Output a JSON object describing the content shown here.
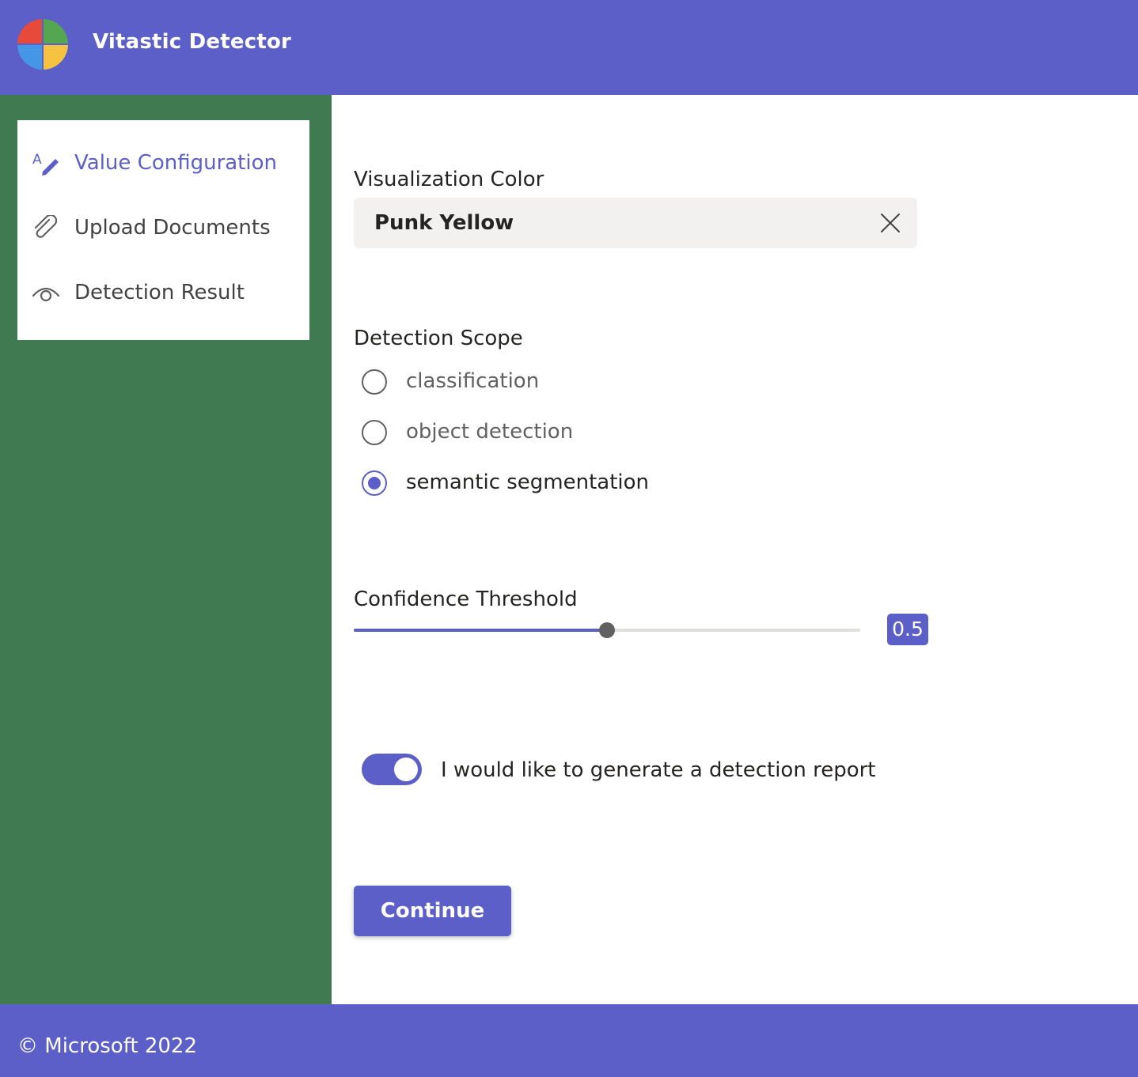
{
  "header": {
    "app_title": "Vitastic Detector",
    "logo_icon": "microsoft-style-logo",
    "logo_colors": [
      "#e64a3b",
      "#54a651",
      "#4596e6",
      "#f5c242"
    ],
    "background": "#5b5fc7"
  },
  "sidebar": {
    "background": "#3f7a50",
    "items": [
      {
        "label": "Value Configuration",
        "icon": "text-edit-icon",
        "active": true
      },
      {
        "label": "Upload Documents",
        "icon": "paperclip-icon",
        "active": false
      },
      {
        "label": "Detection Result",
        "icon": "eye-icon",
        "active": false
      }
    ]
  },
  "form": {
    "color": {
      "label": "Visualization Color",
      "value": "Punk Yellow",
      "clear_icon": "close-icon"
    },
    "scope": {
      "label": "Detection Scope",
      "options": [
        {
          "label": "classification",
          "checked": false
        },
        {
          "label": "object detection",
          "checked": false
        },
        {
          "label": "semantic segmentation",
          "checked": true
        }
      ]
    },
    "threshold": {
      "label": "Confidence Threshold",
      "value": "0.5",
      "fraction": 0.5
    },
    "report": {
      "label": "I would like to generate a detection report",
      "enabled": true
    },
    "continue_label": "Continue"
  },
  "footer": {
    "copyright": "© Microsoft 2022"
  },
  "colors": {
    "accent": "#5b5fc7",
    "sidebar_green": "#3f7a50",
    "input_bg": "#f2f1f0"
  }
}
